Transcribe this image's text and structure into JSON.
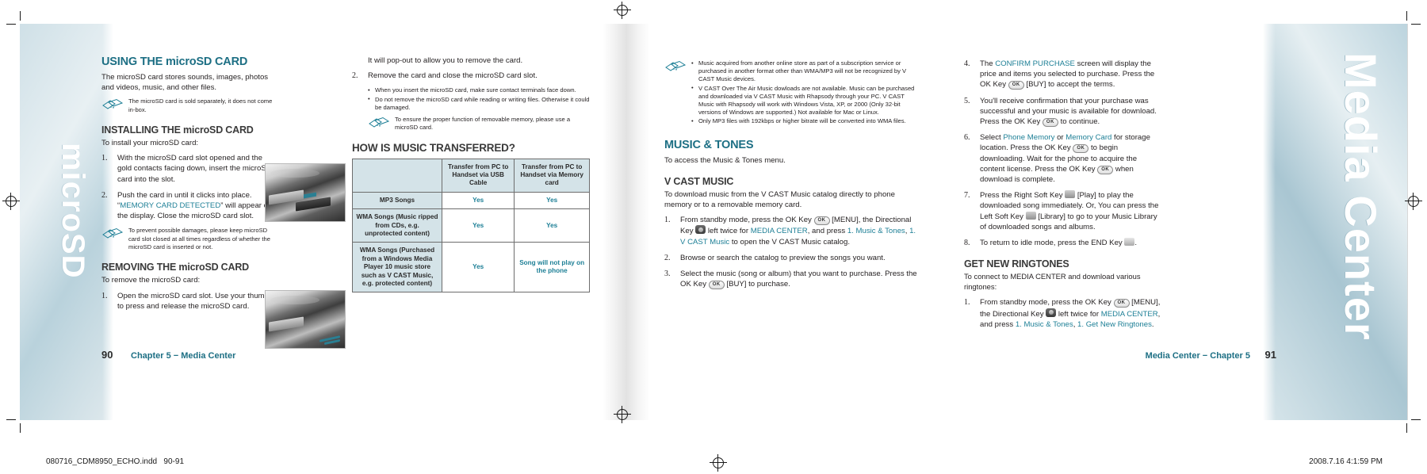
{
  "document": {
    "print_footer_left": "080716_CDM8950_ECHO.indd   90-91",
    "print_footer_right": "2008.7.16   4:1:59 PM",
    "tab_left_label": "microSD",
    "tab_right_label": "Media Center"
  },
  "left_page": {
    "folio_number": "90",
    "folio_text": "Chapter 5 − Media Center"
  },
  "right_page": {
    "folio_number": "91",
    "folio_text": "Media Center − Chapter 5"
  },
  "col1": {
    "section_title": "USING THE microSD CARD",
    "intro": "The microSD card stores sounds, images, photos and videos, music, and other files.",
    "note1": "The microSD card is sold separately, it does not come in-box.",
    "sub1": "INSTALLING THE microSD CARD",
    "sub1_lead": "To install your microSD card:",
    "steps1": [
      "With the microSD card slot opened and the gold contacts facing down, insert the microSD card into the slot.",
      "Push the card in until it clicks into place. “MEMORY CARD DETECTED” will appear on the display. Close the microSD card slot."
    ],
    "step2_pre": "Push the card in until it clicks into place. “",
    "step2_accent": "MEMORY CARD DETECTED",
    "step2_post": "” will appear on the display. Close the microSD card slot.",
    "note2": "To prevent possible damages, please keep microSD card slot closed at all times regardless of whether the microSD card is inserted or not.",
    "sub2": "REMOVING THE microSD CARD",
    "sub2_lead": "To remove the microSD card:",
    "steps2": [
      "Open the microSD card slot. Use your thumb to press and release the microSD card."
    ]
  },
  "col2": {
    "continued_line": "It will pop-out to allow you to remove the card.",
    "step2": "Remove the card and close the microSD card slot.",
    "bullets": [
      "When you insert the microSD card, make sure contact terminals face down.",
      "Do not remove the microSD card while reading or writing files. Otherwise it could be damaged."
    ],
    "note": "To ensure the proper function of removable memory, please use a microSD card.",
    "table_title": "HOW IS MUSIC TRANSFERRED?"
  },
  "chart_data": {
    "type": "table",
    "title": "HOW IS MUSIC TRANSFERRED?",
    "columns": [
      "",
      "Transfer from PC to Handset via USB Cable",
      "Transfer from PC to Handset via Memory card"
    ],
    "rows": [
      {
        "label": "MP3 Songs",
        "values": [
          "Yes",
          "Yes"
        ]
      },
      {
        "label": "WMA Songs (Music ripped from CDs, e.g. unprotected content)",
        "values": [
          "Yes",
          "Yes"
        ]
      },
      {
        "label": "WMA Songs (Purchased from a Windows Media Player 10 music store such as V CAST Music, e.g. protected content)",
        "values": [
          "Yes",
          "Song will not play on the phone"
        ]
      }
    ]
  },
  "col3": {
    "notes": [
      "Music acquired from another online store as part of a subscription service or purchased in another format other than WMA/MP3 will not be recognized by V CAST Music devices.",
      "V CAST Over The Air Music dowloads are not available. Music can be purchased and downloaded via V CAST Music with Rhapsody through your PC. V CAST Music with Rhapsody will work with Windows Vista, XP, or 2000 (Only 32-bit versions of Windows are supported.) Not available for Mac or Linux.",
      "Only MP3 files with 192kbps or higher bitrate will be converted into WMA files."
    ],
    "section_title": "MUSIC & TONES",
    "section_lead": "To access the Music & Tones menu.",
    "sub1": "V CAST MUSIC",
    "sub1_lead": "To download music from the V CAST Music catalog directly to phone memory or to a removable memory card.",
    "step1": {
      "p1": "From standby mode, press the OK Key ",
      "p2": " [MENU], the Directional Key ",
      "p3": " left twice for ",
      "accent1": "MEDIA CENTER",
      "p4": ", and press ",
      "accent2": "1. Music & Tones",
      "p5": ", ",
      "accent3": "1. V CAST Music",
      "p6": " to open the V CAST Music catalog."
    },
    "step2": "Browse or search the catalog to preview the songs you want.",
    "step3": {
      "p1": "Select the music (song or album) that you want to purchase. Press the OK Key ",
      "p2": " [BUY] to purchase."
    }
  },
  "col4": {
    "step4": {
      "p1": "The ",
      "accent": "CONFIRM PURCHASE",
      "p2": " screen will display the price and items you selected to purchase. Press the OK Key ",
      "p3": " [BUY] to accept the terms."
    },
    "step5": {
      "p1": "You'll receive confirmation that your purchase was successful and your music is available for download. Press the OK Key ",
      "p2": " to continue."
    },
    "step6": {
      "p1": "Select ",
      "accent1": "Phone Memory",
      "p2": " or ",
      "accent2": "Memory Card",
      "p3": " for storage location. Press the OK Key ",
      "p4": " to begin downloading. Wait for the phone to acquire the content license. Press the OK Key ",
      "p5": " when download is complete."
    },
    "step7": {
      "p1": "Press the Right Soft Key ",
      "p2": " [Play] to play the downloaded song immediately. Or, You can press the Left Soft Key ",
      "p3": " [Library] to go to your Music Library of downloaded songs and albums."
    },
    "step8": {
      "p1": "To return to idle mode, press the END Key ",
      "p2": "."
    },
    "sub1": "GET NEW RINGTONES",
    "sub1_lead": "To connect to MEDIA CENTER and download various ringtones:",
    "step9": {
      "p1": "From standby mode, press the OK Key ",
      "p2": " [MENU], the Directional Key ",
      "p3": " left twice for ",
      "accent1": "MEDIA CENTER",
      "p4": ", and press ",
      "accent2": "1. Music & Tones",
      "p5": ", ",
      "accent3": "1. Get New Ringtones",
      "p6": "."
    }
  },
  "colors": {
    "accent_teal": "#1d7f96",
    "heading_teal": "#1d6f84",
    "table_header_bg": "#d4e3e8"
  }
}
